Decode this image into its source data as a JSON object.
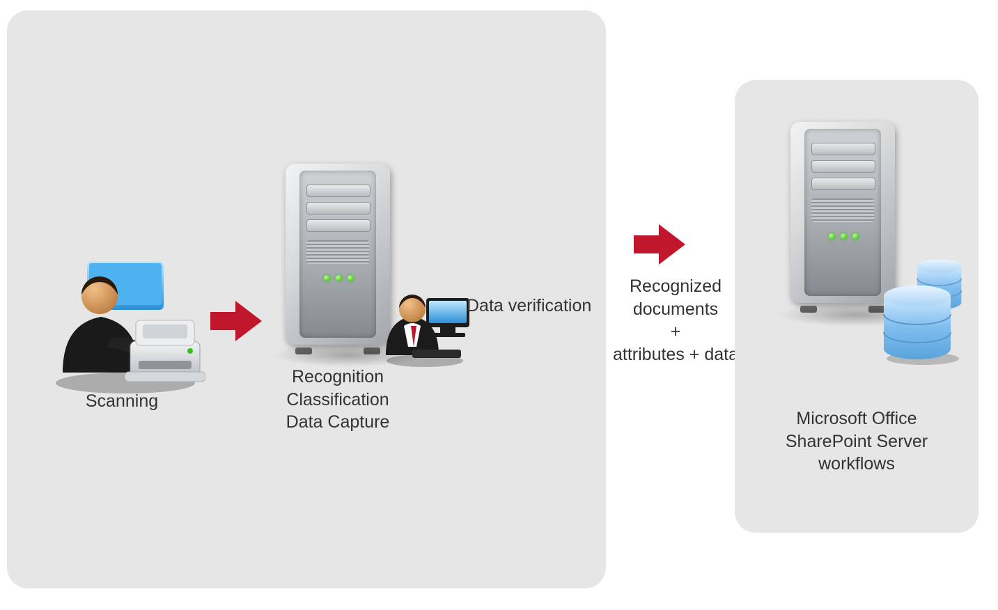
{
  "stages": {
    "scanning": {
      "label": "Scanning"
    },
    "processing": {
      "line1": "Recognition",
      "line2": "Classification",
      "line3": "Data Capture"
    },
    "verification": {
      "label": "Data verification"
    }
  },
  "transfer": {
    "line1": "Recognized",
    "line2": "documents",
    "line3": "+",
    "line4": "attributes + data"
  },
  "destination": {
    "line1": "Microsoft Office",
    "line2": "SharePoint Server",
    "line3": "workflows"
  },
  "colors": {
    "arrow": "#c0172d",
    "panel": "#e7e6e6"
  }
}
